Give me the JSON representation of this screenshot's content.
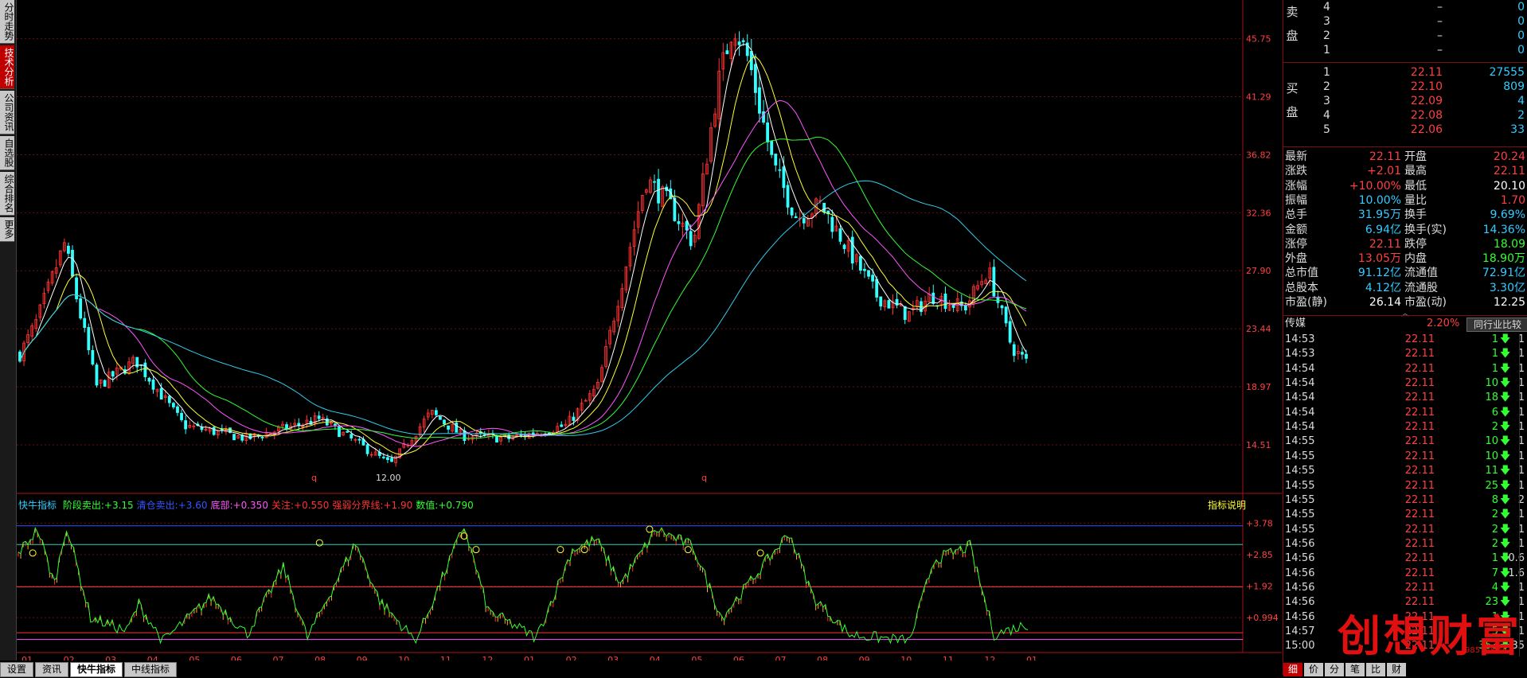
{
  "left_tabs": [
    {
      "label": "分时走势",
      "active": false
    },
    {
      "label": "技术分析",
      "active": true
    },
    {
      "label": "公司资讯",
      "active": false
    },
    {
      "label": "自选股",
      "active": false
    },
    {
      "label": "综合排名",
      "active": false
    },
    {
      "label": "更多",
      "active": false
    }
  ],
  "price_axis": [
    "45.75",
    "41.29",
    "36.82",
    "32.36",
    "27.90",
    "23.44",
    "18.97",
    "14.51"
  ],
  "low_marker": "12.00",
  "q_marks": [
    "q",
    "q"
  ],
  "indicator": {
    "name": "快牛指标",
    "params": [
      {
        "label": "阶段卖出:",
        "value": "+3.15",
        "color": "#33ff33"
      },
      {
        "label": "清仓卖出:",
        "value": "+3.60",
        "color": "#3355ff"
      },
      {
        "label": "底部:",
        "value": "+0.350",
        "color": "#ff55ff"
      },
      {
        "label": "关注:",
        "value": "+0.550",
        "color": "#ff3333"
      },
      {
        "label": "强弱分界线:",
        "value": "+1.90",
        "color": "#ff3333"
      },
      {
        "label": "数值:",
        "value": "+0.790",
        "color": "#33ff33"
      }
    ],
    "help": "指标说明",
    "axis": [
      "+3.78",
      "+2.85",
      "+1.92",
      "+0.994"
    ]
  },
  "month_axis": [
    "01",
    "02",
    "03",
    "04",
    "05",
    "06",
    "07",
    "08",
    "09",
    "10",
    "11",
    "12",
    "01",
    "02",
    "03",
    "04",
    "05",
    "06",
    "07",
    "08",
    "09",
    "10",
    "11",
    "12",
    "01"
  ],
  "bottom_tabs": [
    {
      "label": "设置",
      "active": false
    },
    {
      "label": "资讯",
      "active": false
    },
    {
      "label": "快牛指标",
      "active": true
    },
    {
      "label": "中线指标",
      "active": false
    }
  ],
  "sell_label": "卖盘",
  "buy_label": "买盘",
  "sell": [
    {
      "level": "4",
      "price": "–",
      "vol": "0"
    },
    {
      "level": "3",
      "price": "–",
      "vol": "0"
    },
    {
      "level": "2",
      "price": "–",
      "vol": "0"
    },
    {
      "level": "1",
      "price": "–",
      "vol": "0"
    }
  ],
  "buy": [
    {
      "level": "1",
      "price": "22.11",
      "vol": "27555"
    },
    {
      "level": "2",
      "price": "22.10",
      "vol": "809"
    },
    {
      "level": "3",
      "price": "22.09",
      "vol": "4"
    },
    {
      "level": "4",
      "price": "22.08",
      "vol": "2"
    },
    {
      "level": "5",
      "price": "22.06",
      "vol": "33"
    }
  ],
  "stats": [
    {
      "l": "最新",
      "v": "22.11",
      "c": "#ff4040",
      "l2": "开盘",
      "v2": "20.24",
      "c2": "#ff4040"
    },
    {
      "l": "涨跌",
      "v": "+2.01",
      "c": "#ff4040",
      "l2": "最高",
      "v2": "22.11",
      "c2": "#ff4040"
    },
    {
      "l": "涨幅",
      "v": "+10.00%",
      "c": "#ff4040",
      "l2": "最低",
      "v2": "20.10",
      "c2": "#ffffff"
    },
    {
      "l": "振幅",
      "v": "10.00%",
      "c": "#33ccff",
      "l2": "量比",
      "v2": "1.70",
      "c2": "#ff4040"
    },
    {
      "l": "总手",
      "v": "31.95万",
      "c": "#33ccff",
      "l2": "换手",
      "v2": "9.69%",
      "c2": "#33ccff"
    },
    {
      "l": "金额",
      "v": "6.94亿",
      "c": "#33ccff",
      "l2": "换手(实)",
      "v2": "14.36%",
      "c2": "#33ccff"
    },
    {
      "l": "涨停",
      "v": "22.11",
      "c": "#ff4040",
      "l2": "跌停",
      "v2": "18.09",
      "c2": "#33ff33"
    },
    {
      "l": "外盘",
      "v": "13.05万",
      "c": "#ff4040",
      "l2": "内盘",
      "v2": "18.90万",
      "c2": "#33ff33"
    },
    {
      "l": "总市值",
      "v": "91.12亿",
      "c": "#33ccff",
      "l2": "流通值",
      "v2": "72.91亿",
      "c2": "#33ccff"
    },
    {
      "l": "总股本",
      "v": "4.12亿",
      "c": "#33ccff",
      "l2": "流通股",
      "v2": "3.30亿",
      "c2": "#33ccff"
    },
    {
      "l": "市盈(静)",
      "v": "26.14",
      "c": "#ffffff",
      "l2": "市盈(动)",
      "v2": "12.25",
      "c2": "#ffffff"
    }
  ],
  "sector": {
    "name": "传媒",
    "change": "2.20%",
    "compare_btn": "同行业比较"
  },
  "ticks": [
    {
      "t": "14:53",
      "p": "22.11",
      "v": "1",
      "e": "1"
    },
    {
      "t": "14:53",
      "p": "22.11",
      "v": "1",
      "e": "1"
    },
    {
      "t": "14:54",
      "p": "22.11",
      "v": "1",
      "e": "1"
    },
    {
      "t": "14:54",
      "p": "22.11",
      "v": "10",
      "e": "1"
    },
    {
      "t": "14:54",
      "p": "22.11",
      "v": "18",
      "e": "1"
    },
    {
      "t": "14:54",
      "p": "22.11",
      "v": "6",
      "e": "1"
    },
    {
      "t": "14:54",
      "p": "22.11",
      "v": "2",
      "e": "1"
    },
    {
      "t": "14:55",
      "p": "22.11",
      "v": "10",
      "e": "1"
    },
    {
      "t": "14:55",
      "p": "22.11",
      "v": "10",
      "e": "1"
    },
    {
      "t": "14:55",
      "p": "22.11",
      "v": "11",
      "e": "1"
    },
    {
      "t": "14:55",
      "p": "22.11",
      "v": "25",
      "e": "1"
    },
    {
      "t": "14:55",
      "p": "22.11",
      "v": "8",
      "e": "2"
    },
    {
      "t": "14:55",
      "p": "22.11",
      "v": "2",
      "e": "1"
    },
    {
      "t": "14:55",
      "p": "22.11",
      "v": "2",
      "e": "1"
    },
    {
      "t": "14:56",
      "p": "22.11",
      "v": "2",
      "e": "1"
    },
    {
      "t": "14:56",
      "p": "22.11",
      "v": "1",
      "e": "0.6"
    },
    {
      "t": "14:56",
      "p": "22.11",
      "v": "7",
      "e": "1.6"
    },
    {
      "t": "14:56",
      "p": "22.11",
      "v": "4",
      "e": "1"
    },
    {
      "t": "14:56",
      "p": "22.11",
      "v": "23",
      "e": "1"
    },
    {
      "t": "14:56",
      "p": "22.11",
      "v": "1",
      "e": "1"
    },
    {
      "t": "14:57",
      "p": "22.11",
      "v": "5",
      "e": "1"
    },
    {
      "t": "15:00",
      "p": "22.11",
      "v": "353",
      "e": "35"
    }
  ],
  "side_bottom_tabs": [
    {
      "label": "细",
      "active": true
    },
    {
      "label": "价",
      "active": false
    },
    {
      "label": "分",
      "active": false
    },
    {
      "label": "笔",
      "active": false
    },
    {
      "label": "比",
      "active": false
    },
    {
      "label": "财",
      "active": false
    }
  ],
  "watermark": "创想财富",
  "watermark_url": "985168.cn",
  "colors": {
    "up": "#ff3333",
    "down": "#33ffff",
    "ma5": "#ffffff",
    "ma10": "#ffff33",
    "ma20": "#ff55ff",
    "ma30": "#33ff33",
    "ma60": "#33ccee"
  }
}
